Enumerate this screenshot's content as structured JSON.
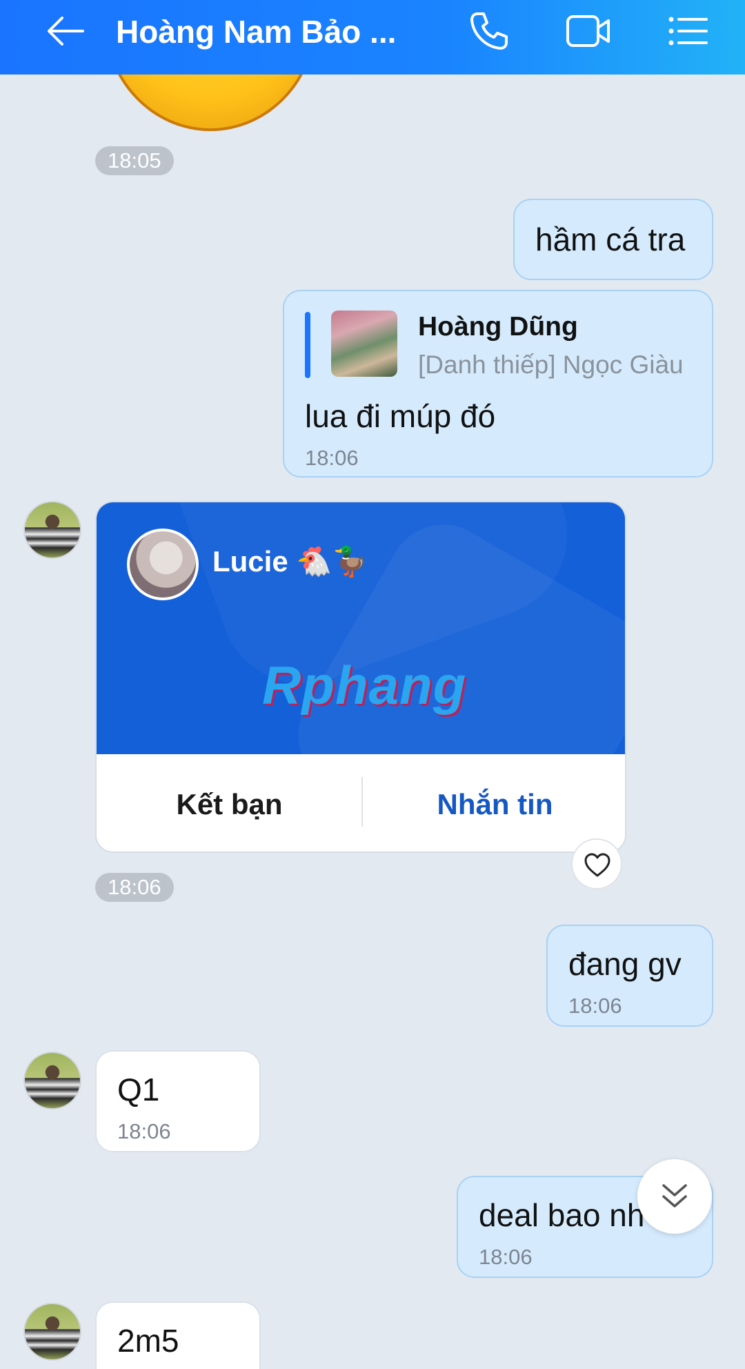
{
  "header": {
    "title": "Hoàng Nam Bảo ...",
    "back_icon": "arrow-left-icon",
    "call_icon": "phone-icon",
    "video_icon": "video-camera-icon",
    "menu_icon": "list-menu-icon"
  },
  "messages": {
    "pill_1": "18:05",
    "m1": {
      "text": "hầm cá tra"
    },
    "m2": {
      "reply_name": "Hoàng Dũng",
      "reply_preview": "[Danh thiếp] Ngọc Giàu",
      "text": "lua đi múp đó",
      "time": "18:06"
    },
    "card": {
      "name": "Lucie 🐔🦆",
      "watermark": "Rphang",
      "add_friend": "Kết bạn",
      "message": "Nhắn tin"
    },
    "pill_2": "18:06",
    "m3": {
      "text": "đang gv",
      "time": "18:06"
    },
    "m4": {
      "text": "Q1",
      "time": "18:06"
    },
    "m5": {
      "text": "deal bao nh",
      "time": "18:06"
    },
    "m6": {
      "text": "2m5"
    }
  },
  "colors": {
    "header_blue": "#1a74ff",
    "my_bubble": "#d5ebfd",
    "card_blue": "#1460d8",
    "link_blue": "#1558c4"
  }
}
